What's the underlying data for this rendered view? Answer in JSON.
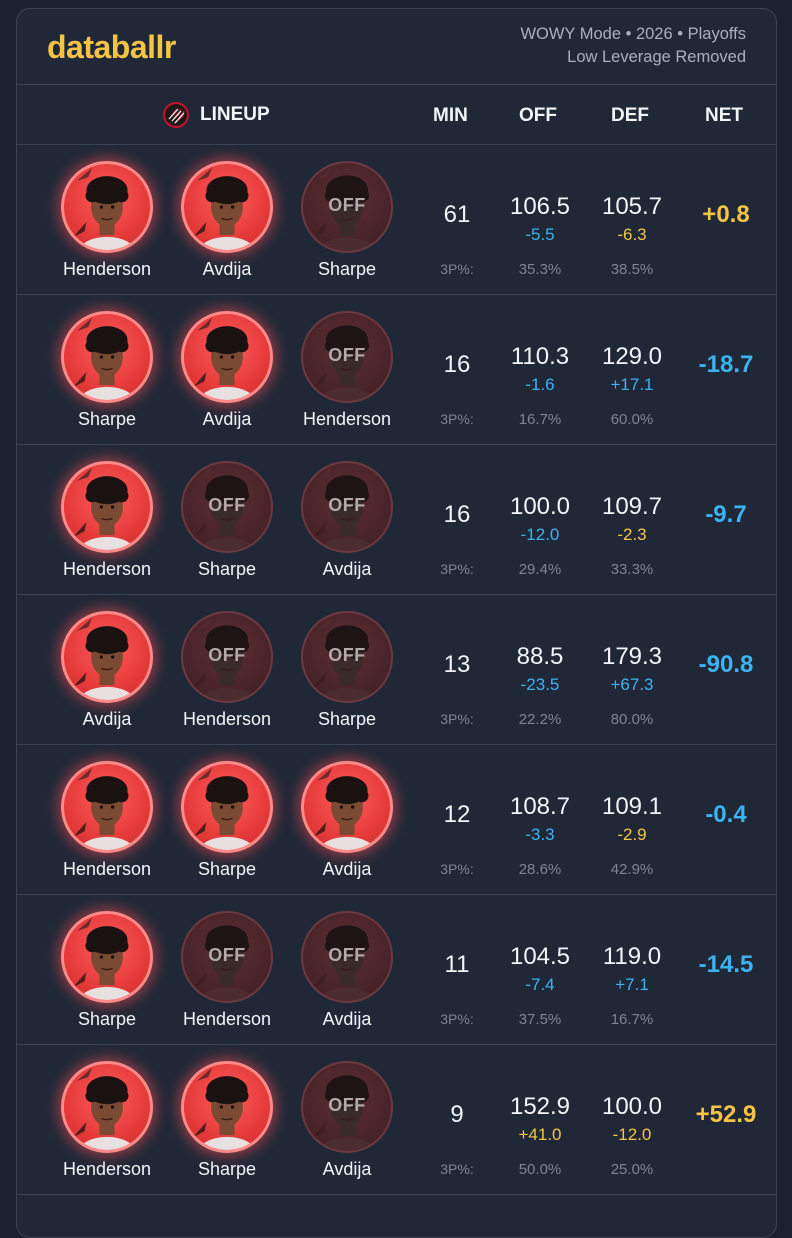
{
  "header": {
    "logo": "databallr",
    "meta_line1": "WOWY Mode • 2026 • Playoffs",
    "meta_line2": "Low Leverage Removed"
  },
  "columns": {
    "lineup": "LINEUP",
    "min": "MIN",
    "off": "OFF",
    "def": "DEF",
    "net": "NET"
  },
  "team_icon": "trail-blazers-logo-icon",
  "colors": {
    "accent": "#f6c445",
    "blue": "#3db2f0",
    "on_player": "#e53a3a",
    "off_player": "#472329"
  },
  "off_label": "OFF",
  "three_pt_label": "3P%:",
  "rows": [
    {
      "players": [
        {
          "name": "Henderson",
          "status": "on"
        },
        {
          "name": "Avdija",
          "status": "on"
        },
        {
          "name": "Sharpe",
          "status": "off"
        }
      ],
      "min": "61",
      "off": "106.5",
      "off_delta": "-5.5",
      "off_delta_color": "blue",
      "off_3p": "35.3%",
      "def": "105.7",
      "def_delta": "-6.3",
      "def_delta_color": "gold",
      "def_3p": "38.5%",
      "net": "+0.8",
      "net_color": "gold"
    },
    {
      "players": [
        {
          "name": "Sharpe",
          "status": "on"
        },
        {
          "name": "Avdija",
          "status": "on"
        },
        {
          "name": "Henderson",
          "status": "off"
        }
      ],
      "min": "16",
      "off": "110.3",
      "off_delta": "-1.6",
      "off_delta_color": "blue",
      "off_3p": "16.7%",
      "def": "129.0",
      "def_delta": "+17.1",
      "def_delta_color": "blue",
      "def_3p": "60.0%",
      "net": "-18.7",
      "net_color": "blue"
    },
    {
      "players": [
        {
          "name": "Henderson",
          "status": "on"
        },
        {
          "name": "Sharpe",
          "status": "off"
        },
        {
          "name": "Avdija",
          "status": "off"
        }
      ],
      "min": "16",
      "off": "100.0",
      "off_delta": "-12.0",
      "off_delta_color": "blue",
      "off_3p": "29.4%",
      "def": "109.7",
      "def_delta": "-2.3",
      "def_delta_color": "gold",
      "def_3p": "33.3%",
      "net": "-9.7",
      "net_color": "blue"
    },
    {
      "players": [
        {
          "name": "Avdija",
          "status": "on"
        },
        {
          "name": "Henderson",
          "status": "off"
        },
        {
          "name": "Sharpe",
          "status": "off"
        }
      ],
      "min": "13",
      "off": "88.5",
      "off_delta": "-23.5",
      "off_delta_color": "blue",
      "off_3p": "22.2%",
      "def": "179.3",
      "def_delta": "+67.3",
      "def_delta_color": "blue",
      "def_3p": "80.0%",
      "net": "-90.8",
      "net_color": "blue"
    },
    {
      "players": [
        {
          "name": "Henderson",
          "status": "on"
        },
        {
          "name": "Sharpe",
          "status": "on"
        },
        {
          "name": "Avdija",
          "status": "on"
        }
      ],
      "min": "12",
      "off": "108.7",
      "off_delta": "-3.3",
      "off_delta_color": "blue",
      "off_3p": "28.6%",
      "def": "109.1",
      "def_delta": "-2.9",
      "def_delta_color": "gold",
      "def_3p": "42.9%",
      "net": "-0.4",
      "net_color": "blue"
    },
    {
      "players": [
        {
          "name": "Sharpe",
          "status": "on"
        },
        {
          "name": "Henderson",
          "status": "off"
        },
        {
          "name": "Avdija",
          "status": "off"
        }
      ],
      "min": "11",
      "off": "104.5",
      "off_delta": "-7.4",
      "off_delta_color": "blue",
      "off_3p": "37.5%",
      "def": "119.0",
      "def_delta": "+7.1",
      "def_delta_color": "blue",
      "def_3p": "16.7%",
      "net": "-14.5",
      "net_color": "blue"
    },
    {
      "players": [
        {
          "name": "Henderson",
          "status": "on"
        },
        {
          "name": "Sharpe",
          "status": "on"
        },
        {
          "name": "Avdija",
          "status": "off"
        }
      ],
      "min": "9",
      "off": "152.9",
      "off_delta": "+41.0",
      "off_delta_color": "gold",
      "off_3p": "50.0%",
      "def": "100.0",
      "def_delta": "-12.0",
      "def_delta_color": "gold",
      "def_3p": "25.0%",
      "net": "+52.9",
      "net_color": "gold"
    }
  ]
}
